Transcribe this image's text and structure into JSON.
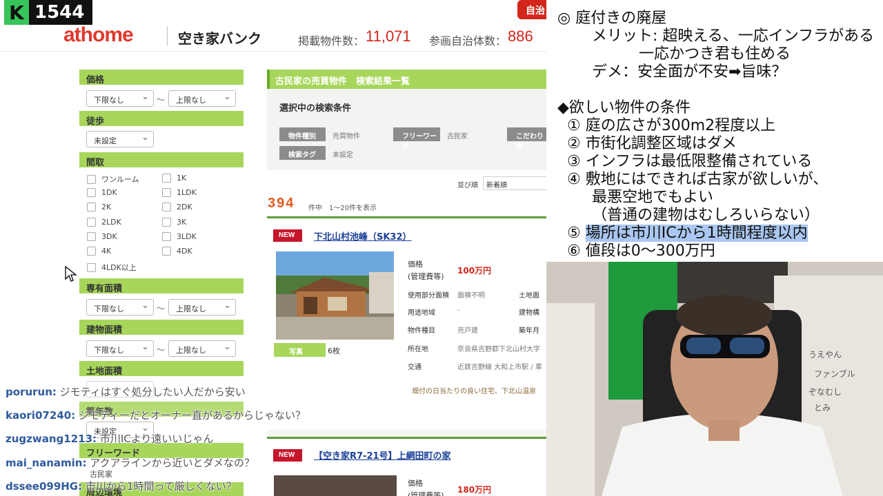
{
  "overlay": {
    "viewer_count": "1544",
    "k_icon": "K"
  },
  "site": {
    "logo": "athome",
    "subtitle": "空き家バンク",
    "listings_label": "掲載物件数：",
    "listings_value": "11,071",
    "municipalities_label": "参画自治体数：",
    "municipalities_value": "886",
    "top_tab": "自治"
  },
  "filters": {
    "price": {
      "label": "価格",
      "min": "下限なし",
      "tilde": "〜",
      "max": "上限なし"
    },
    "walk": {
      "label": "徒歩",
      "value": "未設定"
    },
    "layout": {
      "label": "間取",
      "options": [
        "ワンルーム",
        "1K",
        "1DK",
        "1LDK",
        "2K",
        "2DK",
        "2LDK",
        "3K",
        "3DK",
        "3LDK",
        "4K",
        "4DK",
        "4LDK以上"
      ]
    },
    "exclusive_area": {
      "label": "専有面積",
      "min": "下限なし",
      "tilde": "〜",
      "max": "上限なし"
    },
    "building_area": {
      "label": "建物面積",
      "min": "下限なし",
      "tilde": "〜",
      "max": "上限なし"
    },
    "land_area": {
      "label": "土地面積"
    },
    "partial_labels": [
      "築年数",
      "未設定",
      "フリーワード",
      "古民家",
      "周辺環境"
    ]
  },
  "results": {
    "header": "古民家の売買物件　検索結果一覧",
    "conditions_title": "選択中の検索条件",
    "tags": [
      {
        "label": "物件種別",
        "value": "売買物件"
      },
      {
        "label": "フリーワード",
        "value": "古民家"
      },
      {
        "label": "こだわり条",
        "value": ""
      },
      {
        "label": "検索タグ",
        "value": "未設定"
      }
    ],
    "sort_label": "並び順",
    "sort_value": "新着順",
    "count": "394",
    "count_suffix": "件中　1〜20件を表示"
  },
  "listing1": {
    "badge": "NEW",
    "title": "下北山村池峰（SK32）",
    "photo_tag": "写真",
    "photo_count": "6枚",
    "price_label": "価格",
    "price_sub": "(管理費等)",
    "price": "100万円",
    "rows": [
      {
        "label": "使用部分面積",
        "value": "面積不明",
        "label2": "土地面"
      },
      {
        "label": "用途地域",
        "value": "-",
        "label2": "建物構"
      },
      {
        "label": "物件種目",
        "value": "売戸建",
        "label2": "築年月"
      },
      {
        "label": "所在地",
        "value": "奈良県吉野郡下北山村大字"
      },
      {
        "label": "交通",
        "value": "近鉄吉野線 大和上市駅 / 車"
      }
    ],
    "note": "畑付の日当たりの良い住宅、下北山温泉"
  },
  "listing2": {
    "badge": "NEW",
    "title": "【空き家R7-21号】上網田町の家",
    "price_label": "価格",
    "price_sub": "(管理費等)",
    "price": "180万円"
  },
  "notes": {
    "line1": "◎ 庭付きの廃屋",
    "line2": "メリット: 超映える、一応インフラがある",
    "line3": "一応かつき君も住める",
    "line4": "デメ：安全面が不安➡旨味？",
    "line5": "◆欲しい物件の条件",
    "c1": "① 庭の広さが300m2程度以上",
    "c2": "② 市街化調整区域はダメ",
    "c3": "③ インフラは最低限整備されている",
    "c4": "④ 敷地にはできれば古家が欲しいが、",
    "c4b": "最悪空地でもよい",
    "c4c": "（普通の建物はむしろいらない）",
    "c5_num": "⑤ ",
    "c5": "場所は市川ICから1時間程度以内",
    "c6": "⑥ 値段は0〜300万円"
  },
  "camera": {
    "names": [
      "うえやん",
      "ファンブル",
      "ぞなむし",
      "とみ"
    ]
  },
  "chat": [
    {
      "user": "porurun:",
      "msg": "ジモティはすぐ処分したい人だから安い"
    },
    {
      "user": "kaori07240:",
      "msg": "ジモティーだとオーナー直があるからじゃない？"
    },
    {
      "user": "zugzwang1213:",
      "msg": "市川ICより遠いいじゃん"
    },
    {
      "user": "mai_nanamin:",
      "msg": "アクアラインから近いとダメなの？"
    },
    {
      "user": "dssee099HG:",
      "msg": "市川から1時間って厳しくない？"
    }
  ]
}
